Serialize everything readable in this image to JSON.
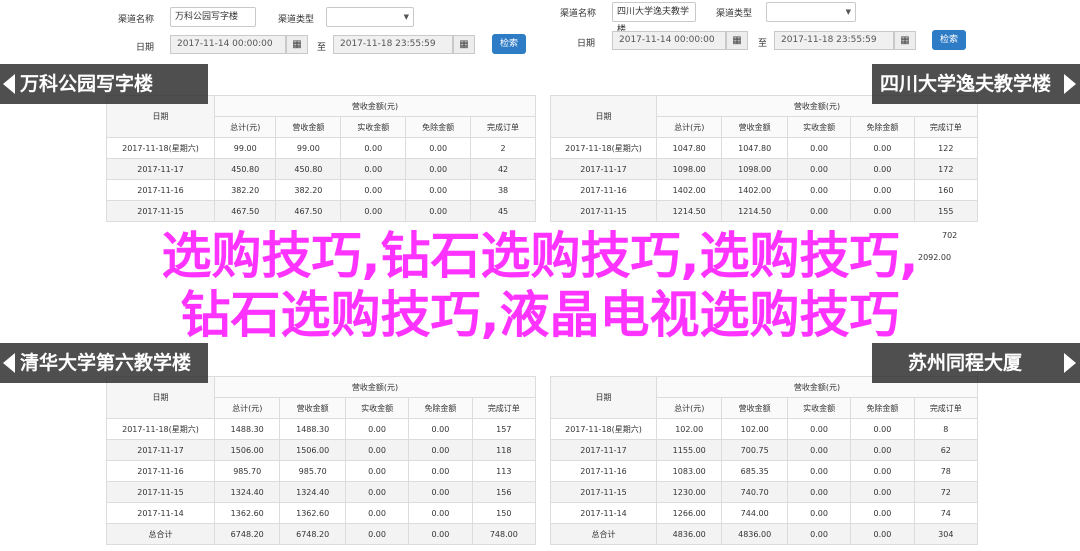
{
  "filters": {
    "type_name_label": "渠道名称",
    "type_label": "渠道类型",
    "date_label": "日期",
    "to_label": "至",
    "search_button": "检索",
    "calendar_icon": "calendar-grid-icon"
  },
  "panels": [
    {
      "channel_value": "万科公园写字楼",
      "banner": "万科公园写字楼",
      "date_from": "2017-11-14 00:00:00",
      "date_to": "2017-11-18 23:55:59",
      "headers": {
        "date": "日期",
        "group": "营收金额(元)",
        "cols": [
          "总计(元)",
          "营收金额",
          "实收金额",
          "免除金额",
          "完成订单"
        ]
      },
      "rows": [
        [
          "2017-11-18(星期六)",
          "99.00",
          "99.00",
          "0.00",
          "0.00",
          "2"
        ],
        [
          "2017-11-17",
          "450.80",
          "450.80",
          "0.00",
          "0.00",
          "42"
        ],
        [
          "2017-11-16",
          "382.20",
          "382.20",
          "0.00",
          "0.00",
          "38"
        ],
        [
          "2017-11-15",
          "467.50",
          "467.50",
          "0.00",
          "0.00",
          "45"
        ]
      ]
    },
    {
      "channel_value": "四川大学逸夫教学楼",
      "banner": "四川大学逸夫教学楼",
      "date_from": "2017-11-14 00:00:00",
      "date_to": "2017-11-18 23:55:59",
      "headers": {
        "date": "日期",
        "group": "营收金额(元)",
        "cols": [
          "总计(元)",
          "营收金额",
          "实收金额",
          "免除金额",
          "完成订单"
        ]
      },
      "rows": [
        [
          "2017-11-18(星期六)",
          "1047.80",
          "1047.80",
          "0.00",
          "0.00",
          "122"
        ],
        [
          "2017-11-17",
          "1098.00",
          "1098.00",
          "0.00",
          "0.00",
          "172"
        ],
        [
          "2017-11-16",
          "1402.00",
          "1402.00",
          "0.00",
          "0.00",
          "160"
        ],
        [
          "2017-11-15",
          "1214.50",
          "1214.50",
          "0.00",
          "0.00",
          "155"
        ]
      ],
      "partial_last": "2092.00",
      "partial_last_tail": "702"
    },
    {
      "banner": "清华大学第六教学楼",
      "headers": {
        "date": "日期",
        "group": "营收金额(元)",
        "cols": [
          "总计(元)",
          "营收金额",
          "实收金额",
          "免除金额",
          "完成订单"
        ]
      },
      "rows": [
        [
          "2017-11-18(星期六)",
          "1488.30",
          "1488.30",
          "0.00",
          "0.00",
          "157"
        ],
        [
          "2017-11-17",
          "1506.00",
          "1506.00",
          "0.00",
          "0.00",
          "118"
        ],
        [
          "2017-11-16",
          "985.70",
          "985.70",
          "0.00",
          "0.00",
          "113"
        ],
        [
          "2017-11-15",
          "1324.40",
          "1324.40",
          "0.00",
          "0.00",
          "156"
        ],
        [
          "2017-11-14",
          "1362.60",
          "1362.60",
          "0.00",
          "0.00",
          "150"
        ],
        [
          "总合计",
          "6748.20",
          "6748.20",
          "0.00",
          "0.00",
          "748.00"
        ]
      ]
    },
    {
      "banner": "苏州同程大厦",
      "headers": {
        "date": "日期",
        "group": "营收金额(元)",
        "cols": [
          "总计(元)",
          "营收金额",
          "实收金额",
          "免除金额",
          "完成订单"
        ]
      },
      "rows": [
        [
          "2017-11-18(星期六)",
          "102.00",
          "102.00",
          "0.00",
          "0.00",
          "8"
        ],
        [
          "2017-11-17",
          "1155.00",
          "700.75",
          "0.00",
          "0.00",
          "62"
        ],
        [
          "2017-11-16",
          "1083.00",
          "685.35",
          "0.00",
          "0.00",
          "78"
        ],
        [
          "2017-11-15",
          "1230.00",
          "740.70",
          "0.00",
          "0.00",
          "72"
        ],
        [
          "2017-11-14",
          "1266.00",
          "744.00",
          "0.00",
          "0.00",
          "74"
        ],
        [
          "总合计",
          "4836.00",
          "4836.00",
          "0.00",
          "0.00",
          "304"
        ]
      ]
    }
  ],
  "overlay": {
    "line1": "选购技巧,钻石选购技巧,选购技巧,",
    "line2": "钻石选购技巧,液晶电视选购技巧"
  },
  "colors": {
    "overlay_text": "#ff33ff",
    "search_button": "#2f7cc6",
    "banner_bg": "#282828"
  }
}
